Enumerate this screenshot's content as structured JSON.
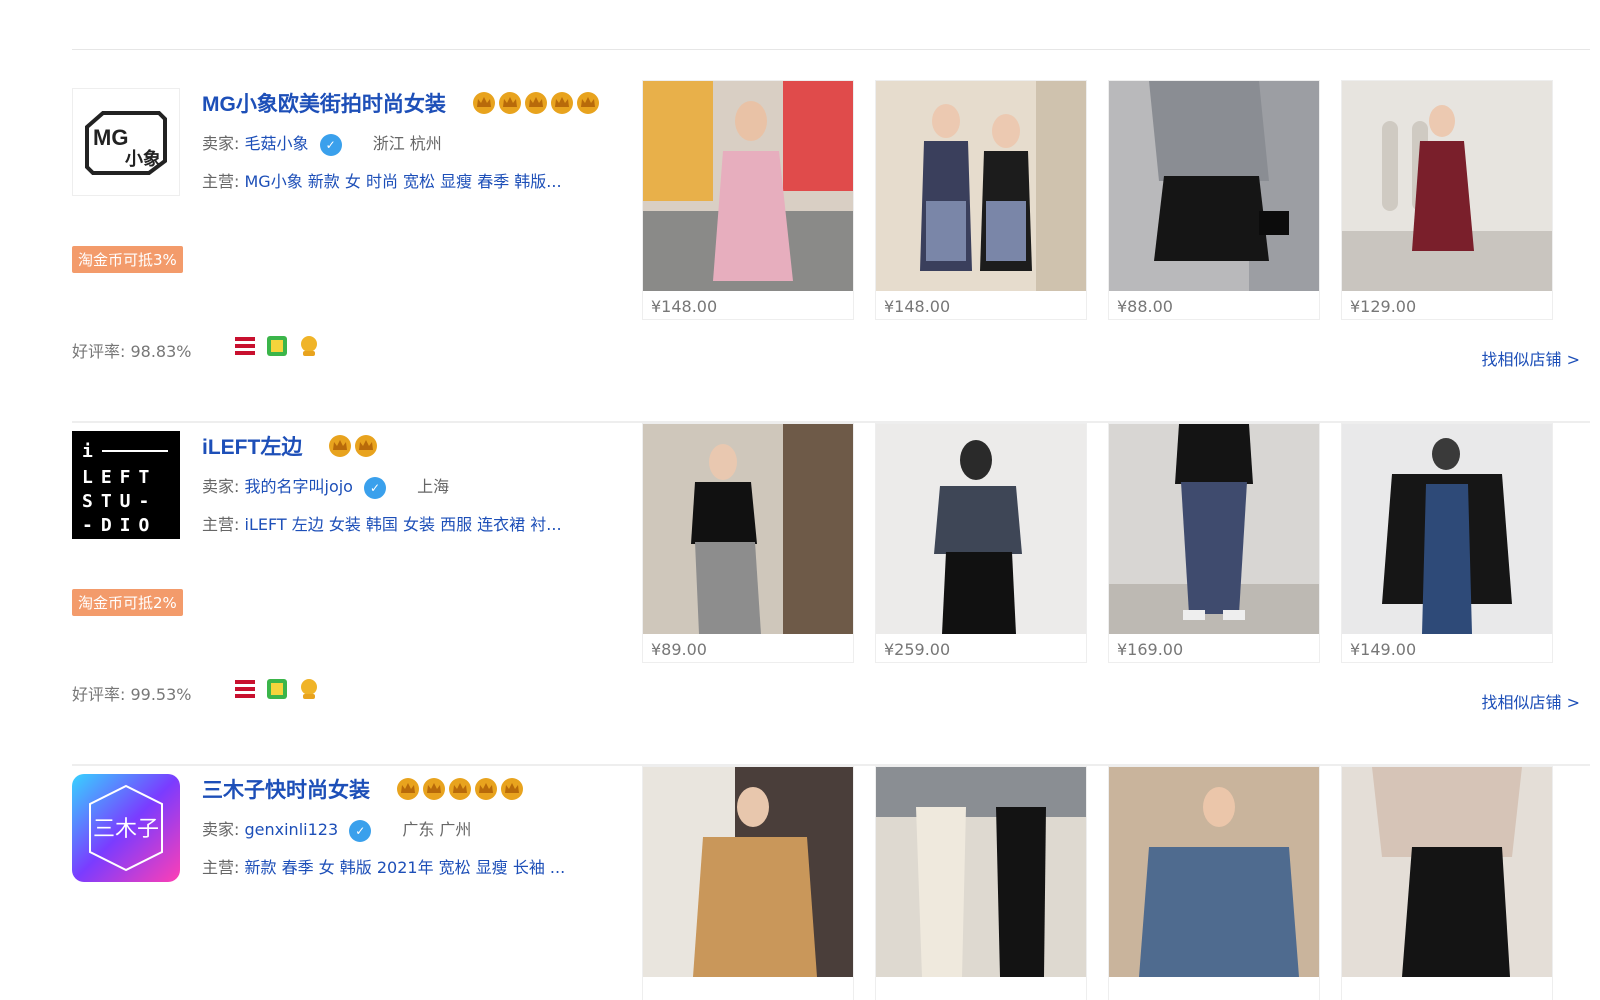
{
  "shops": [
    {
      "name": "MG小象欧美街拍时尚女装",
      "crowns": 5,
      "seller_label": "卖家:",
      "seller": "毛菇小象",
      "location": "浙江 杭州",
      "main_label": "主营:",
      "main": "MG小象 新款 女 时尚 宽松 显瘦 春季 韩版...",
      "coin_tag": "淘金币可抵3%",
      "rating": "好评率: 98.83%",
      "similar": "找相似店铺 >",
      "logo": "MG 小象",
      "products": [
        {
          "price": "¥148.00"
        },
        {
          "price": "¥148.00"
        },
        {
          "price": "¥88.00"
        },
        {
          "price": "¥129.00"
        }
      ]
    },
    {
      "name": "iLEFT左边",
      "crowns": 2,
      "seller_label": "卖家:",
      "seller": "我的名字叫jojo",
      "location": "上海",
      "main_label": "主营:",
      "main": "iLEFT 左边 女装 韩国 女装 西服 连衣裙 衬...",
      "coin_tag": "淘金币可抵2%",
      "rating": "好评率: 99.53%",
      "similar": "找相似店铺 >",
      "logo": "LEFT STUDIO",
      "products": [
        {
          "price": "¥89.00"
        },
        {
          "price": "¥259.00"
        },
        {
          "price": "¥169.00"
        },
        {
          "price": "¥149.00"
        }
      ]
    },
    {
      "name": "三木子快时尚女装",
      "crowns": 5,
      "seller_label": "卖家:",
      "seller": "genxinli123",
      "location": "广东 广州",
      "main_label": "主营:",
      "main": "新款 春季 女 韩版 2021年 宽松 显瘦 长袖 ...",
      "logo": "三木子",
      "products": [
        {
          "price": ""
        },
        {
          "price": ""
        },
        {
          "price": ""
        },
        {
          "price": ""
        }
      ]
    }
  ],
  "colors": {
    "link": "#1d4fb8",
    "coin_tag": "#f39b6b",
    "crown": "#e8a31e",
    "verified": "#3aa0ec"
  },
  "icons": [
    "crown-icon",
    "verified-icon",
    "consumer-protection-icon",
    "gold-seller-icon",
    "service-icon"
  ]
}
